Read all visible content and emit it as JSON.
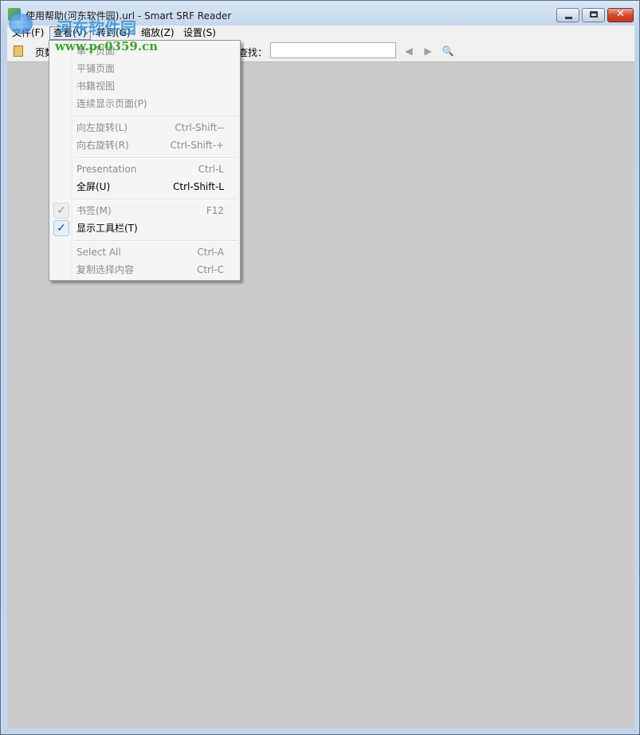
{
  "window": {
    "title": "使用帮助(河东软件园).url - Smart SRF Reader",
    "close_glyph": "✕"
  },
  "watermark": {
    "site_name": "河东软件园",
    "url": "www.pc0359.cn"
  },
  "menubar": {
    "items": [
      {
        "label": "文件(F)"
      },
      {
        "label": "查看(V)"
      },
      {
        "label": "转到(G)"
      },
      {
        "label": "缩放(Z)"
      },
      {
        "label": "设置(S)"
      }
    ]
  },
  "toolbar": {
    "page_label": "页数",
    "search_label": "查找：",
    "search_value": "",
    "prev_glyph": "◀",
    "next_glyph": "▶",
    "find_glyph": "🔍"
  },
  "view_menu": {
    "check_glyph": "✓",
    "items": [
      {
        "label": "单个页面",
        "shortcut": "",
        "enabled": false,
        "checked": false
      },
      {
        "label": "平铺页面",
        "shortcut": "",
        "enabled": false,
        "checked": false
      },
      {
        "label": "书籍视图",
        "shortcut": "",
        "enabled": false,
        "checked": false
      },
      {
        "label": "连续显示页面(P)",
        "shortcut": "",
        "enabled": false,
        "checked": false
      },
      {
        "label": "向左旋转(L)",
        "shortcut": "Ctrl-Shift--",
        "enabled": false,
        "checked": false
      },
      {
        "label": "向右旋转(R)",
        "shortcut": "Ctrl-Shift-+",
        "enabled": false,
        "checked": false
      },
      {
        "label": "Presentation",
        "shortcut": "Ctrl-L",
        "enabled": false,
        "checked": false
      },
      {
        "label": "全屏(U)",
        "shortcut": "Ctrl-Shift-L",
        "enabled": true,
        "checked": false
      },
      {
        "label": "书签(M)",
        "shortcut": "F12",
        "enabled": false,
        "checked": true
      },
      {
        "label": "显示工具栏(T)",
        "shortcut": "",
        "enabled": true,
        "checked": true
      },
      {
        "label": "Select All",
        "shortcut": "Ctrl-A",
        "enabled": false,
        "checked": false
      },
      {
        "label": "复制选择内容",
        "shortcut": "Ctrl-C",
        "enabled": false,
        "checked": false
      }
    ]
  }
}
